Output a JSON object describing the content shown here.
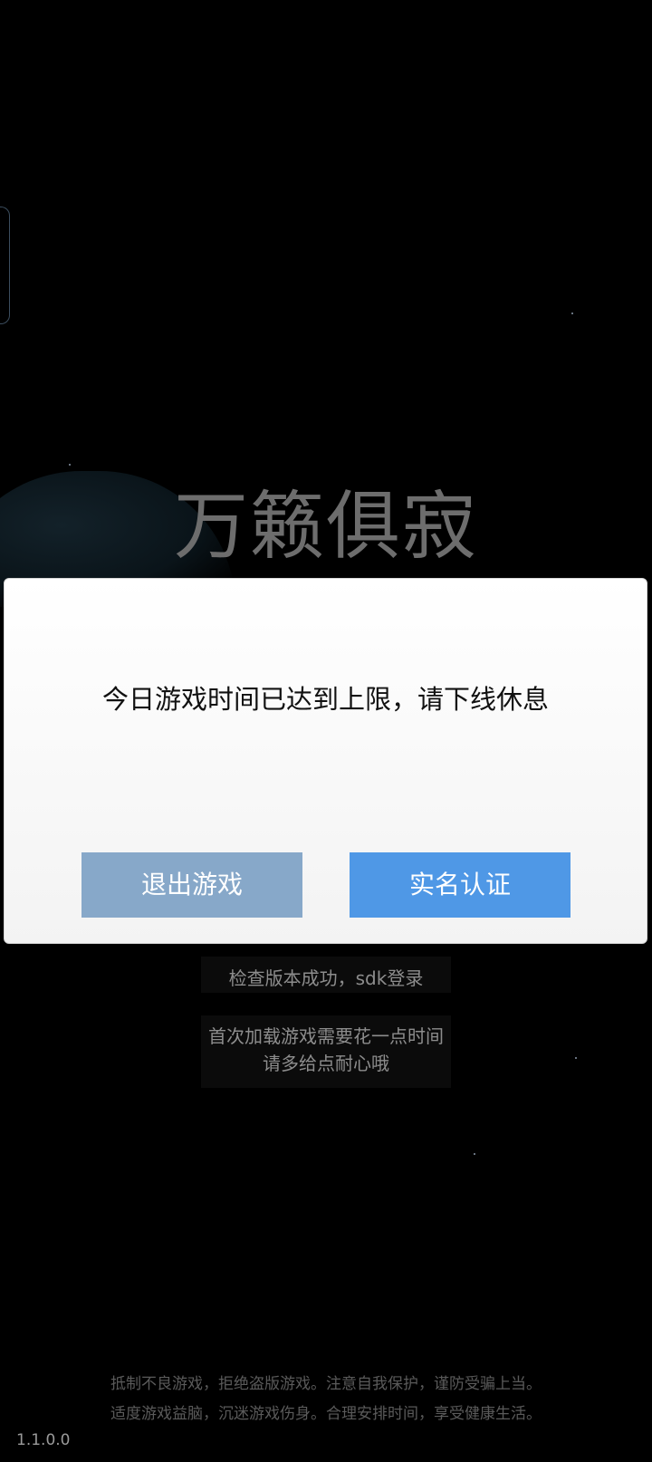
{
  "background": {
    "game_title": "万籁俱寂",
    "status_text": "检查版本成功，sdk登录",
    "loading_hint_line1": "首次加载游戏需要花一点时间",
    "loading_hint_line2": "请多给点耐心哦",
    "health_notice_line1": "抵制不良游戏，拒绝盗版游戏。注意自我保护，谨防受骗上当。",
    "health_notice_line2": "适度游戏益脑，沉迷游戏伤身。合理安排时间，享受健康生活。",
    "version": "1.1.0.0"
  },
  "dialog": {
    "message": "今日游戏时间已达到上限，请下线休息",
    "exit_label": "退出游戏",
    "verify_label": "实名认证"
  },
  "colors": {
    "background": "#000000",
    "exit_button": "#87a8c9",
    "verify_button": "#4f98e6",
    "dialog": "#ffffff"
  }
}
